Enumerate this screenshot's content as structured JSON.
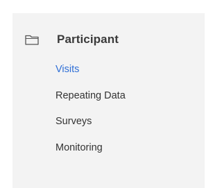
{
  "panel": {
    "section": {
      "icon": "folder-icon",
      "title": "Participant"
    },
    "items": [
      {
        "label": "Visits",
        "active": true
      },
      {
        "label": "Repeating Data",
        "active": false
      },
      {
        "label": "Surveys",
        "active": false
      },
      {
        "label": "Monitoring",
        "active": false
      }
    ]
  },
  "colors": {
    "panel_background": "#f3f3f3",
    "active_link": "#2f6fd6",
    "text": "#333333"
  }
}
